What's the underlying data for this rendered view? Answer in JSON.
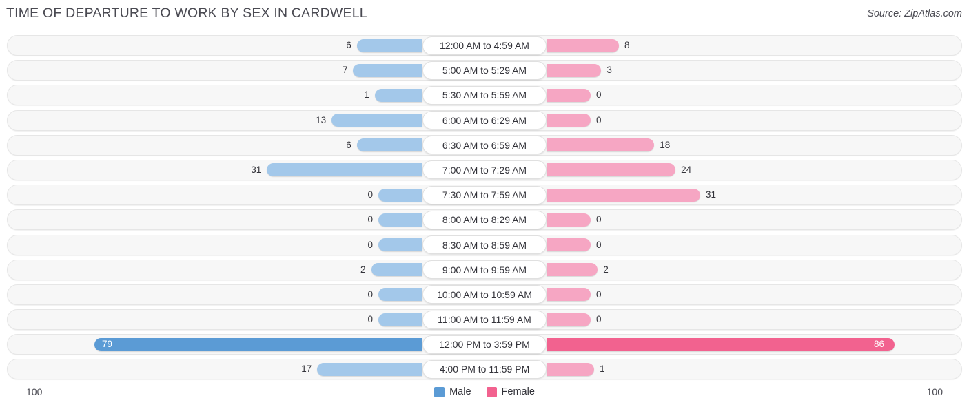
{
  "header": {
    "title": "TIME OF DEPARTURE TO WORK BY SEX IN CARDWELL",
    "source": "Source: ZipAtlas.com"
  },
  "footer": {
    "axis_left": "100",
    "axis_right": "100",
    "legend": [
      {
        "label": "Male",
        "color": "#5b9bd5"
      },
      {
        "label": "Female",
        "color": "#f2628f"
      }
    ]
  },
  "colors": {
    "male_light": "#a3c8ea",
    "male_dark": "#5b9bd5",
    "female_light": "#f6a6c3",
    "female_dark": "#f2628f",
    "track": "#f7f7f7",
    "title": "#4a4a52"
  },
  "chart_data": {
    "type": "bar",
    "subtype": "diverging-bidirectional",
    "title": "TIME OF DEPARTURE TO WORK BY SEX IN CARDWELL",
    "xlabel": "",
    "ylabel": "",
    "xlim": [
      100,
      100
    ],
    "axis_left_max": 100,
    "axis_right_max": 100,
    "grid": false,
    "legend_position": "bottom-center",
    "categories": [
      "12:00 AM to 4:59 AM",
      "5:00 AM to 5:29 AM",
      "5:30 AM to 5:59 AM",
      "6:00 AM to 6:29 AM",
      "6:30 AM to 6:59 AM",
      "7:00 AM to 7:29 AM",
      "7:30 AM to 7:59 AM",
      "8:00 AM to 8:29 AM",
      "8:30 AM to 8:59 AM",
      "9:00 AM to 9:59 AM",
      "10:00 AM to 10:59 AM",
      "11:00 AM to 11:59 AM",
      "12:00 PM to 3:59 PM",
      "4:00 PM to 11:59 PM"
    ],
    "series": [
      {
        "name": "Male",
        "color": "#5b9bd5",
        "direction": "left",
        "values": [
          6,
          7,
          1,
          13,
          6,
          31,
          0,
          0,
          0,
          2,
          0,
          0,
          79,
          17
        ]
      },
      {
        "name": "Female",
        "color": "#f2628f",
        "direction": "right",
        "values": [
          8,
          3,
          0,
          0,
          18,
          24,
          31,
          0,
          0,
          2,
          0,
          0,
          86,
          1
        ]
      }
    ]
  },
  "rows": [
    {
      "label": "12:00 AM to 4:59 AM",
      "male": "6",
      "female": "8"
    },
    {
      "label": "5:00 AM to 5:29 AM",
      "male": "7",
      "female": "3"
    },
    {
      "label": "5:30 AM to 5:59 AM",
      "male": "1",
      "female": "0"
    },
    {
      "label": "6:00 AM to 6:29 AM",
      "male": "13",
      "female": "0"
    },
    {
      "label": "6:30 AM to 6:59 AM",
      "male": "6",
      "female": "18"
    },
    {
      "label": "7:00 AM to 7:29 AM",
      "male": "31",
      "female": "24"
    },
    {
      "label": "7:30 AM to 7:59 AM",
      "male": "0",
      "female": "31"
    },
    {
      "label": "8:00 AM to 8:29 AM",
      "male": "0",
      "female": "0"
    },
    {
      "label": "8:30 AM to 8:59 AM",
      "male": "0",
      "female": "0"
    },
    {
      "label": "9:00 AM to 9:59 AM",
      "male": "2",
      "female": "2"
    },
    {
      "label": "10:00 AM to 10:59 AM",
      "male": "0",
      "female": "0"
    },
    {
      "label": "11:00 AM to 11:59 AM",
      "male": "0",
      "female": "0"
    },
    {
      "label": "12:00 PM to 3:59 PM",
      "male": "79",
      "female": "86"
    },
    {
      "label": "4:00 PM to 11:59 PM",
      "male": "17",
      "female": "1"
    }
  ]
}
